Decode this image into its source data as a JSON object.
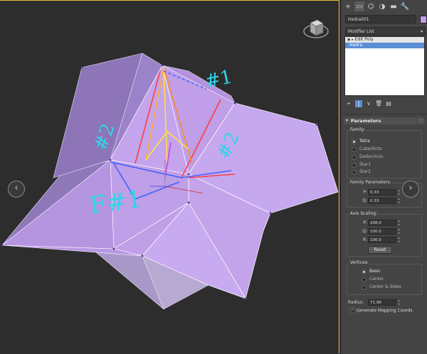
{
  "viewport": {
    "annotations": {
      "label_1": "#1",
      "label_2": "#2",
      "label_3": "#2",
      "label_4": "F#1"
    },
    "nav": {
      "left_arrow": "‹",
      "right_arrow": "›"
    },
    "colors": {
      "mesh": "#c7a6ec",
      "annotation": "#2fd6e8",
      "frame": "#f0c040"
    }
  },
  "panel": {
    "tabs": [
      {
        "icon": "plus-icon",
        "glyph": "+"
      },
      {
        "icon": "modify-icon",
        "glyph": "▭"
      },
      {
        "icon": "hierarchy-icon",
        "glyph": "⌬"
      },
      {
        "icon": "motion-icon",
        "glyph": "◑"
      },
      {
        "icon": "display-icon",
        "glyph": "▬"
      },
      {
        "icon": "utilities-icon",
        "glyph": "🔧"
      }
    ],
    "object_name": "Hedra001",
    "object_color": "#c39ae8",
    "modifier_list": "Modifier List",
    "stack": {
      "edit_poly": "Edit Poly",
      "hedra": "Hedra"
    },
    "tools": [
      {
        "icon": "pin-icon",
        "glyph": "⌖"
      },
      {
        "icon": "show-end-result-icon",
        "glyph": "|"
      },
      {
        "icon": "make-unique-icon",
        "glyph": "∨"
      },
      {
        "icon": "remove-modifier-icon",
        "glyph": "🗑"
      },
      {
        "icon": "configure-icon",
        "glyph": "▤"
      }
    ],
    "parameters": {
      "title": "Parameters",
      "family": {
        "label": "Family:",
        "options": [
          "Tetra",
          "Cube/Octa",
          "Dodec/Icos",
          "Star1",
          "Star2"
        ],
        "selected": "Tetra"
      },
      "family_params": {
        "label": "Family Parameters:",
        "p_label": "P:",
        "p_value": "0.33",
        "q_label": "Q:",
        "q_value": "0.33"
      },
      "axis_scaling": {
        "label": "Axis Scaling:",
        "p_label": "P:",
        "p_value": "208.0",
        "q_label": "Q:",
        "q_value": "100.0",
        "r_label": "R:",
        "r_value": "100.0",
        "reset": "Reset"
      },
      "vertices": {
        "label": "Vertices:",
        "options": [
          "Basic",
          "Center",
          "Center & Sides"
        ],
        "selected": "Basic"
      },
      "radius_label": "Radius:",
      "radius_value": "71.96",
      "gen_mapping": "Generate Mapping Coords."
    }
  }
}
